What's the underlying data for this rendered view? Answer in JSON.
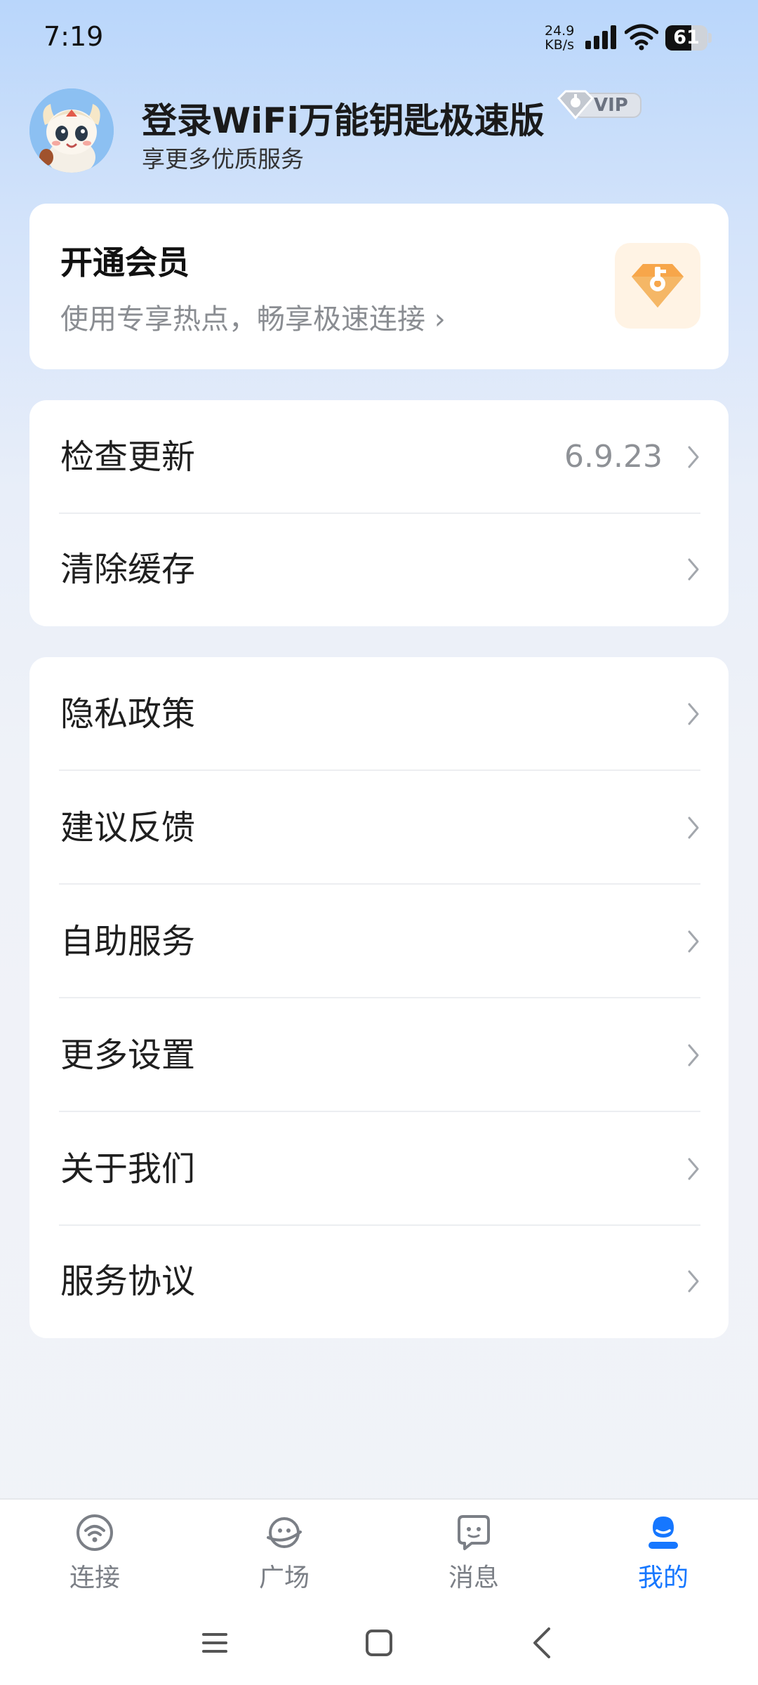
{
  "status_bar": {
    "time": "7:19",
    "net_speed_value": "24.9",
    "net_speed_unit": "KB/s",
    "battery_level": "61",
    "battery_fraction": 0.61
  },
  "profile": {
    "title": "登录WiFi万能钥匙极速版",
    "subtitle": "享更多优质服务",
    "vip_label": "VIP"
  },
  "membership": {
    "title": "开通会员",
    "description": "使用专享热点，畅享极速连接 ›"
  },
  "settings_group_1": [
    {
      "label": "检查更新",
      "value": "6.9.23"
    },
    {
      "label": "清除缓存",
      "value": ""
    }
  ],
  "settings_group_2": [
    {
      "label": "隐私政策"
    },
    {
      "label": "建议反馈"
    },
    {
      "label": "自助服务"
    },
    {
      "label": "更多设置"
    },
    {
      "label": "关于我们"
    },
    {
      "label": "服务协议"
    }
  ],
  "bottom_nav": [
    {
      "label": "连接",
      "icon": "wifi-connect-icon",
      "active": false
    },
    {
      "label": "广场",
      "icon": "plaza-icon",
      "active": false
    },
    {
      "label": "消息",
      "icon": "message-icon",
      "active": false
    },
    {
      "label": "我的",
      "icon": "profile-icon",
      "active": true
    }
  ],
  "colors": {
    "accent": "#1677ff",
    "membership_orange": "#f7a64a",
    "secondary_text": "#8a8d92"
  }
}
